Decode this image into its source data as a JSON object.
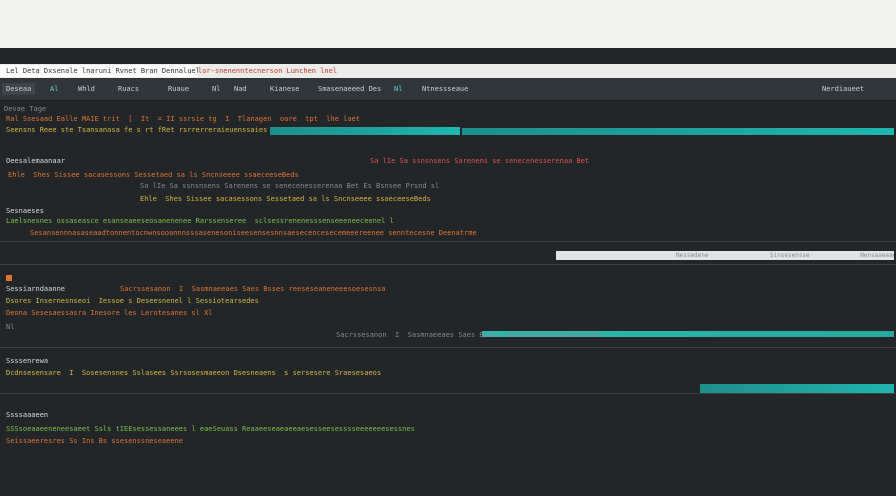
{
  "browser": {
    "tab_title": "Lel Deta Dxsenale lnaruni Rvnet Bran Dennaluel Isde",
    "tab_url": "lor-snenenntecnerson Lunchen lnel"
  },
  "menu": {
    "items": [
      "Deseaa",
      "Al",
      "Whld",
      "Ruacs",
      "Ruaue",
      "Nl",
      "Nad",
      "Kianese",
      "Smasenaeeed Des",
      "Nl",
      "Ntnessseaue",
      "Nerdiaueet"
    ]
  },
  "editor": {
    "sections": [
      {
        "header": "Devae Tage",
        "lines": [
          "Ral Ssesaad Ealle MAIE trit  [  It  = II ssrsie tg  I  Tlanagen  oare  tpt  lhe laet",
          "Seensns Reee ste Tsansanasa fe s rt fRet rsrrerreraieuenssaiesfesstn"
        ]
      },
      {
        "header": "Oeesalemaanaar",
        "lines": [
          "Sa lIe Sa ssnsnsens Sarenens se senecenesserenaa Bet Es Bsnsee Prsnd sl",
          "Ehle  Shes Sissee sacasessons Sessetaed sa ls Sncnseeee ssaeceeseBeds"
        ]
      },
      {
        "header": "Sesnaeses",
        "lines": [
          "Laelsnesnes ossaseasce esanseaeeseosanenenee Rarssenseree  sclsessrenenesssenseeeneeceenel l",
          "Sesansennnasaseaadtonnentocnwnsooannnsssasenesoniseesensesnnsaesecencesecemeeereenee senntecesne Deenatrme"
        ]
      },
      {
        "header": "Sessiarndaanne",
        "lines": [
          "Sacrssesanon  I  Sasmnaeeaes Saes Bsses reeseseaneneeesoesesnsa",
          "Dsores Insernesnseoi  Iessoe s Deseesnenel l Sessiotearsedes",
          "Deona Sesesaessasra Inesore les Lerotesanes sl Xl"
        ]
      },
      {
        "header": "Ssssenrewa",
        "lines": [
          "Dcdnsesensare  I  Sosesensnes Sslasees Ssrsosesmaeeon Dsesneaens  s sersesere Sraesesaeos"
        ]
      },
      {
        "header": "Ssssaaaeen",
        "lines": [
          "SSSsoeaaeeneneesaeet Ssls tIEEsessessaneees l eaeSeuass Reaaeeseaeaeeaesesseesesssseeeeeeesessnes",
          "Seissaeeresres Ss Ins Bs ssesenssneseaeene"
        ]
      }
    ],
    "panel_text": "Nessedene                 Sinsesensse              Nensaaeeaeeael"
  },
  "colors": {
    "background": "#232628",
    "menubar": "#30363a",
    "highlight": "#1fb6ad",
    "orange": "#e0732f",
    "green": "#7ac043"
  }
}
